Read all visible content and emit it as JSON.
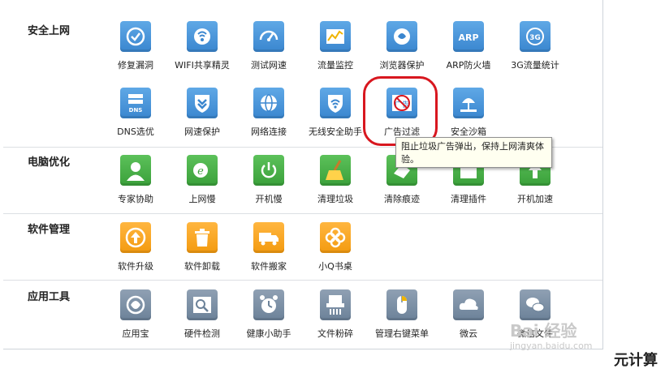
{
  "sections": {
    "security": {
      "title": "安全上网",
      "items": [
        "修复漏洞",
        "WIFI共享精灵",
        "测试网速",
        "流量监控",
        "浏览器保护",
        "ARP防火墙",
        "3G流量统计",
        "DNS选优",
        "网速保护",
        "网络连接",
        "无线安全助手",
        "广告过滤",
        "安全沙箱"
      ]
    },
    "optimize": {
      "title": "电脑优化",
      "items": [
        "专家协助",
        "上网慢",
        "开机慢",
        "清理垃圾",
        "清除痕迹",
        "清理插件",
        "开机加速"
      ]
    },
    "software": {
      "title": "软件管理",
      "items": [
        "软件升级",
        "软件卸载",
        "软件搬家",
        "小Q书桌"
      ]
    },
    "tools": {
      "title": "应用工具",
      "items": [
        "应用宝",
        "硬件检测",
        "健康小助手",
        "文件粉碎",
        "管理右键菜单",
        "微云",
        "微信文件"
      ]
    }
  },
  "icon_text": {
    "arp": "ARP",
    "threeg": "3G",
    "dns": "DNS",
    "ad": "广告"
  },
  "tooltip": {
    "text": "阻止垃圾广告弹出，保持上网清爽体验。"
  },
  "watermark": {
    "main": "Bai 经验",
    "url": "jingyan.baidu.com"
  },
  "brand": "元计算",
  "colors": {
    "tile_blue": "#3a86cf",
    "tile_green": "#3aa03a",
    "tile_orange": "#f39a0f",
    "highlight_red": "#d8171f"
  }
}
